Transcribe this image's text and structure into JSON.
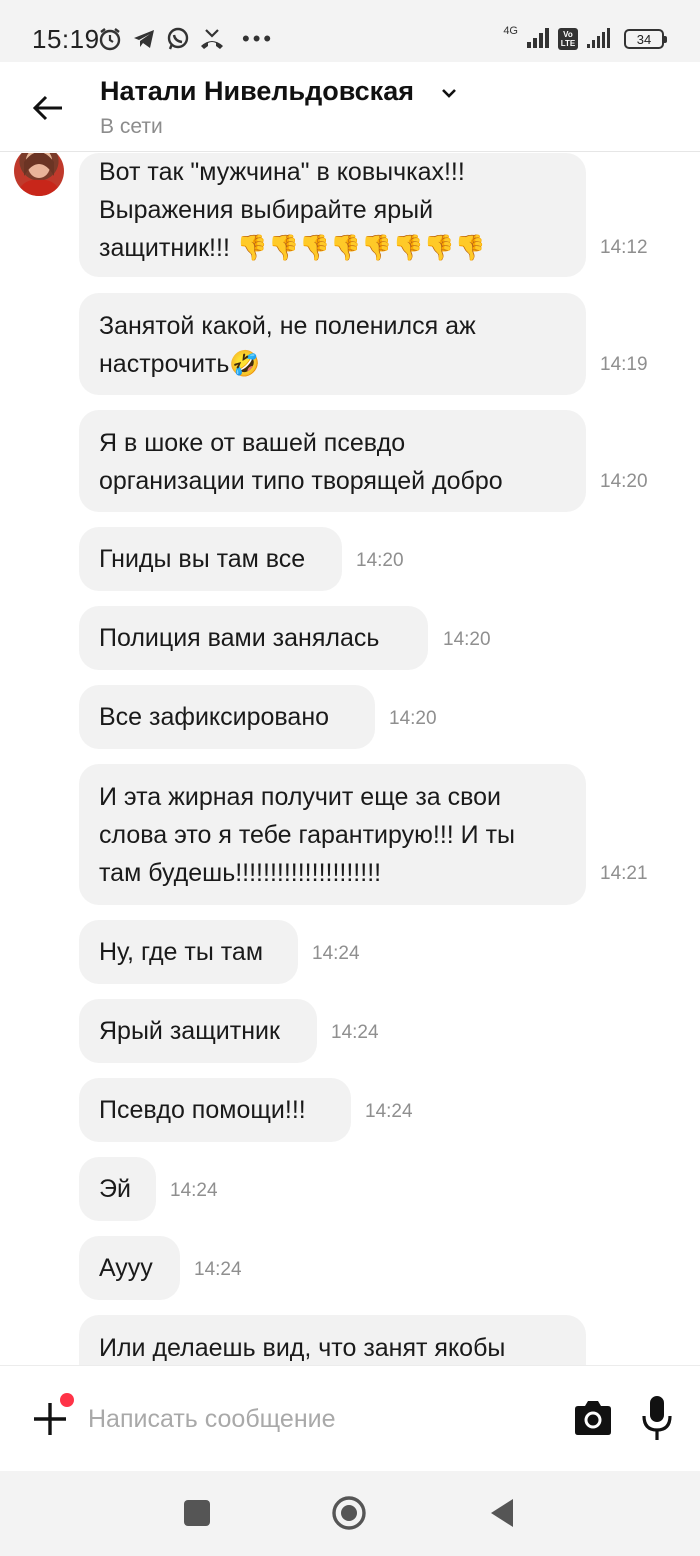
{
  "status_bar": {
    "time": "15:19",
    "network_label": "4G",
    "volte_label": "Vo LTE",
    "battery": "34",
    "more_dots": "•••",
    "icons": [
      "alarm-icon",
      "telegram-icon",
      "whatsapp-icon",
      "missed-call-icon"
    ]
  },
  "header": {
    "name": "Натали Нивельдовская",
    "status": "В сети"
  },
  "messages": [
    {
      "lines": [
        "Вот так \"мужчина\" в ковычках!!!",
        "Выражения выбирайте ярый",
        "защитник!!! 👎👎👎👎👎👎👎👎"
      ],
      "time": "14:12"
    },
    {
      "lines": [
        "Занятой какой, не поленился аж",
        "настрочить🤣"
      ],
      "time": "14:19"
    },
    {
      "lines": [
        "Я в шоке от вашей псевдо",
        "организации типо творящей добро"
      ],
      "time": "14:20"
    },
    {
      "lines": [
        "Гниды вы там все"
      ],
      "time": "14:20"
    },
    {
      "lines": [
        "Полиция вами занялась"
      ],
      "time": "14:20"
    },
    {
      "lines": [
        "Все зафиксировано"
      ],
      "time": "14:20"
    },
    {
      "lines": [
        "И эта жирная получит еще за свои",
        "слова это я тебе гарантирую!!! И ты",
        "там будешь!!!!!!!!!!!!!!!!!!!!!"
      ],
      "time": "14:21"
    },
    {
      "lines": [
        "Ну, где ты там"
      ],
      "time": "14:24"
    },
    {
      "lines": [
        "Ярый защитник"
      ],
      "time": "14:24"
    },
    {
      "lines": [
        "Псевдо помощи!!!"
      ],
      "time": "14:24"
    },
    {
      "lines": [
        "Эй"
      ],
      "time": "14:24"
    },
    {
      "lines": [
        "Ayyy"
      ],
      "time": "14:24"
    },
    {
      "lines": [
        "Или делаешь вид, что занят якобы"
      ],
      "time": ""
    }
  ],
  "input": {
    "placeholder": "Написать сообщение",
    "value": ""
  },
  "colors": {
    "bubble": "#f2f2f2",
    "notification_dot": "#ff3347",
    "timestamp": "#8f8f8f"
  }
}
